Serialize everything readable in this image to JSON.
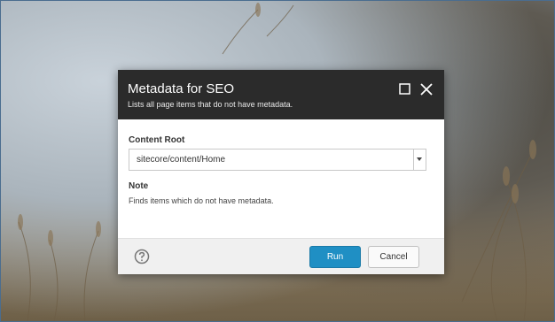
{
  "dialog": {
    "title": "Metadata for SEO",
    "subtitle": "Lists all page items that do not have metadata.",
    "maximize_icon": "maximize-icon",
    "close_icon": "close-icon"
  },
  "form": {
    "content_root_label": "Content Root",
    "content_root_value": "sitecore/content/Home",
    "note_label": "Note",
    "note_text": "Finds items which do not have metadata."
  },
  "footer": {
    "help_icon": "help-icon",
    "run_label": "Run",
    "cancel_label": "Cancel"
  },
  "colors": {
    "header_bg": "#2b2b2b",
    "primary_button": "#1f8fc4",
    "footer_bg": "#f0f0f0"
  }
}
